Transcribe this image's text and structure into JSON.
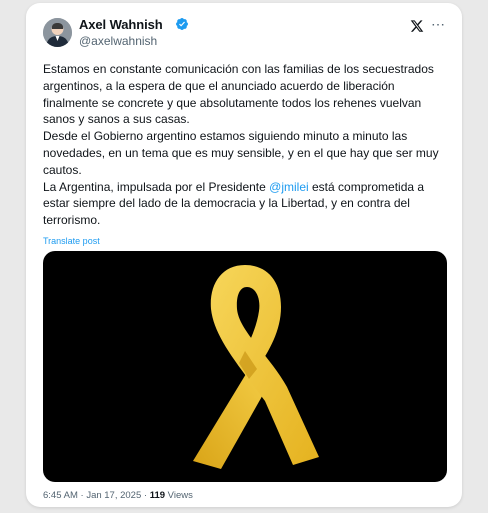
{
  "author": {
    "name": "Axel Wahnish",
    "handle": "@axelwahnish",
    "verified_color": "#1d9bf0"
  },
  "icons": {
    "avatar": "avatar-photo",
    "verified": "verified-badge-icon",
    "platform": "x-logo-icon",
    "more": "more-options-icon"
  },
  "post": {
    "p1": "Estamos en constante comunicación con las familias de los secuestrados argentinos, a la espera de que el anunciado acuerdo de liberación finalmente se concrete y que absolutamente todos los rehenes vuelvan sanos y sanos a sus casas.",
    "p2": "Desde el Gobierno argentino estamos siguiendo minuto a minuto las novedades, en un tema que es muy sensible, y en el que hay que ser muy cautos.",
    "p3_before": "La Argentina, impulsada por el Presidente ",
    "mention": "@jmilei",
    "p3_after": " está comprometida a estar siempre del lado de la democracia y la Libertad, y en contra del terrorismo.",
    "translate_label": "Translate post"
  },
  "media": {
    "description_icon": "yellow-ribbon",
    "ribbon_color": "#f2c23a",
    "background": "#000000"
  },
  "meta": {
    "time": "6:45 AM",
    "separator": " · ",
    "date": "Jan 17, 2025",
    "views_count": "119",
    "views_label": " Views"
  }
}
